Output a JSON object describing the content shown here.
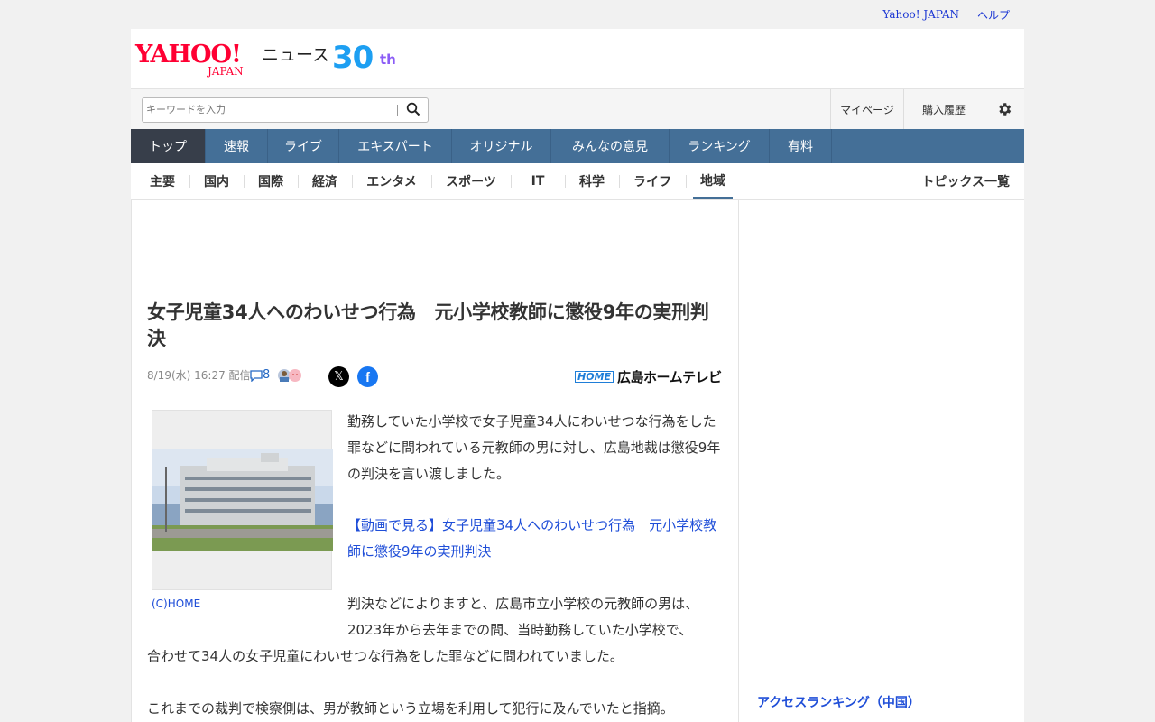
{
  "utility": {
    "yahoo_japan": "Yahoo! JAPAN",
    "help": "ヘルプ"
  },
  "brand": {
    "logo_main": "YAHOO!",
    "logo_sub": "JAPAN",
    "section": "ニュース",
    "anniv_num": "30",
    "anniv_suffix": "th"
  },
  "search": {
    "placeholder": "キーワードを入力"
  },
  "util_buttons": {
    "mypage": "マイページ",
    "history": "購入履歴"
  },
  "mainnav": [
    "トップ",
    "速報",
    "ライブ",
    "エキスパート",
    "オリジナル",
    "みんなの意見",
    "ランキング",
    "有料"
  ],
  "subnav": [
    "主要",
    "国内",
    "国際",
    "経済",
    "エンタメ",
    "スポーツ",
    "IT",
    "科学",
    "ライフ",
    "地域"
  ],
  "subnav_topics": "トピックス一覧",
  "article": {
    "title": "女子児童34人へのわいせつ行為　元小学校教師に懲役9年の実刑判決",
    "date": "8/19(水) 16:27",
    "date_suffix": "配信",
    "comment_count": "8",
    "provider_logo": "HOME",
    "provider_name": "広島ホームテレビ",
    "photo_caption": "(C)HOME",
    "p1": "勤務していた小学校で女子児童34人にわいせつな行為をした罪などに問われている元教師の男に対し、広島地裁は懲役9年の判決を言い渡しました。",
    "video_link": "【動画で見る】女子児童34人へのわいせつ行為　元小学校教師に懲役9年の実刑判決",
    "p2": "判決などによりますと、広島市立小学校の元教師の男は、2023年から去年までの間、当時勤務していた小学校で、",
    "p2b": "合わせて34人の女子児童にわいせつな行為をした罪などに問われていました。",
    "p3": "これまでの裁判で検察側は、男が教師という立場を利用して犯行に及んでいたと指摘。"
  },
  "sidebar": {
    "ranking_title": "アクセスランキング（中国）"
  },
  "colors": {
    "nav_bg": "#446f97",
    "nav_active": "#373e4a",
    "link": "#1f4ed8",
    "brand_red": "#ff0033"
  }
}
